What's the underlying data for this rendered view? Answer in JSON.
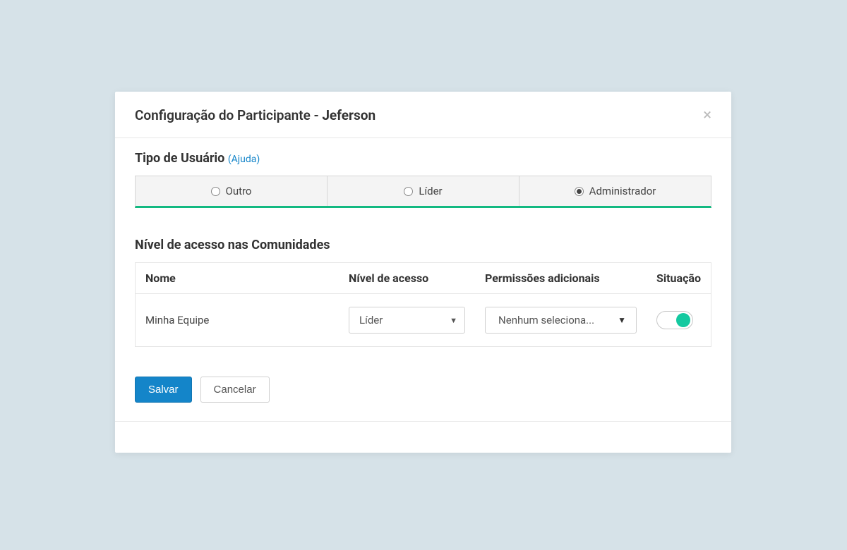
{
  "modal": {
    "title_prefix": "Configuração do Participante - ",
    "title_name": "Jeferson",
    "close_icon": "×"
  },
  "user_type": {
    "section_label": "Tipo de Usuário",
    "help_label": "(Ajuda)",
    "options": {
      "0": {
        "label": "Outro",
        "selected": false
      },
      "1": {
        "label": "Líder",
        "selected": false
      },
      "2": {
        "label": "Administrador",
        "selected": true
      }
    }
  },
  "communities": {
    "section_label": "Nível de acesso nas Comunidades",
    "headers": {
      "name": "Nome",
      "level": "Nível de acesso",
      "perms": "Permissões adicionais",
      "status": "Situação"
    },
    "rows": {
      "0": {
        "name": "Minha Equipe",
        "level": "Líder",
        "perms": "Nenhum seleciona...",
        "status_on": true
      }
    }
  },
  "buttons": {
    "save": "Salvar",
    "cancel": "Cancelar"
  },
  "icons": {
    "caret_down": "▼"
  }
}
